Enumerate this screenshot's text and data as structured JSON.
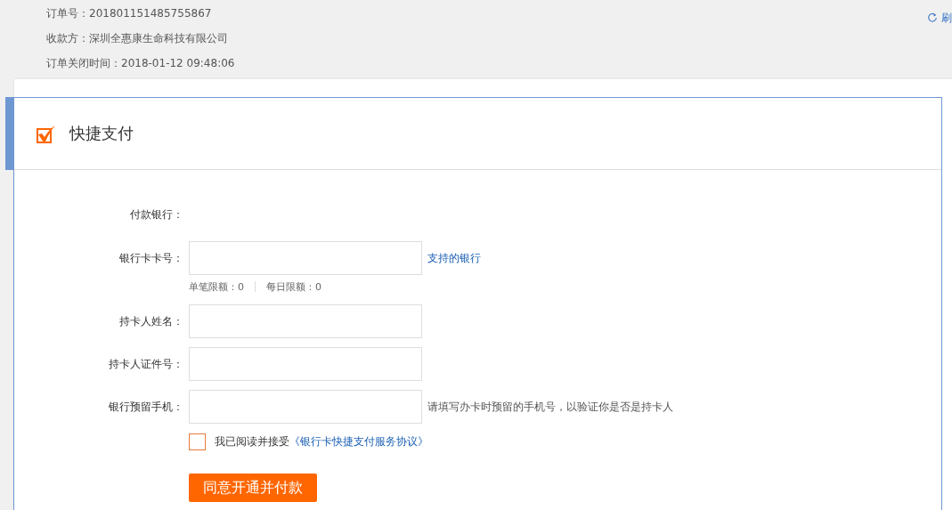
{
  "order_info": [
    {
      "label": "订单号：",
      "value": "201801151485755867"
    },
    {
      "label": "收款方：",
      "value": "深圳全惠康生命科技有限公司"
    },
    {
      "label": "订单关闭时间：",
      "value": "2018-01-12 09:48:06"
    }
  ],
  "refresh_label": "刷",
  "payment_method": {
    "title": "快捷支付",
    "checked": true
  },
  "fields": [
    {
      "kind": "text",
      "label": "付款银行："
    },
    {
      "kind": "input",
      "label": "银行卡卡号：",
      "link": "支持的银行",
      "limits": [
        "单笔限额：0",
        "每日限额：0"
      ]
    },
    {
      "kind": "input",
      "label": "持卡人姓名："
    },
    {
      "kind": "input",
      "label": "持卡人证件号："
    },
    {
      "kind": "input",
      "label": "银行预留手机：",
      "hint": "请填写办卡时预留的手机号，以验证你是否是持卡人"
    }
  ],
  "agreement": {
    "checked": false,
    "text": "我已阅读并接受",
    "link": "《银行卡快捷支付服务协议》"
  },
  "submit_button": "同意开通并付款"
}
